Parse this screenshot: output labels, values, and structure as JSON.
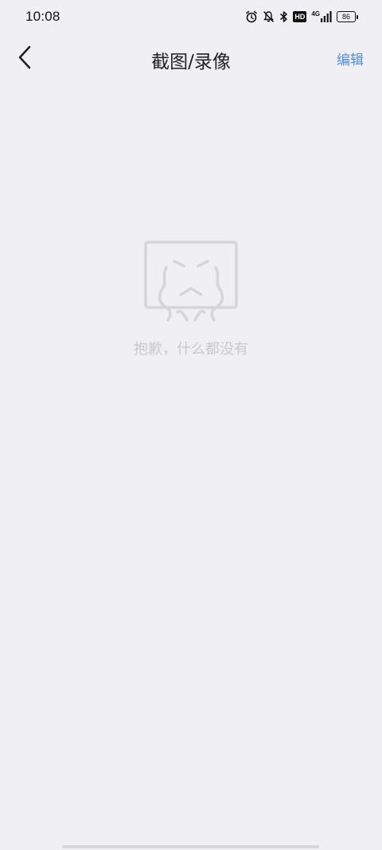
{
  "status_bar": {
    "time": "10:08",
    "icons": [
      "alarm-icon",
      "mute-icon",
      "bluetooth-icon",
      "hd-icon",
      "signal-4g-icon",
      "battery-icon"
    ],
    "hd_label": "HD",
    "network_label": "4G",
    "battery_level": "86"
  },
  "header": {
    "back_icon": "back-arrow-icon",
    "title": "截图/录像",
    "edit_label": "编辑"
  },
  "empty_state": {
    "icon": "crying-face-icon",
    "message": "抱歉，什么都没有"
  },
  "colors": {
    "background": "#efeff4",
    "accent": "#4e8ed9",
    "title": "#222222",
    "empty_text": "#c9c9cd",
    "empty_icon": "#d6d6da"
  }
}
